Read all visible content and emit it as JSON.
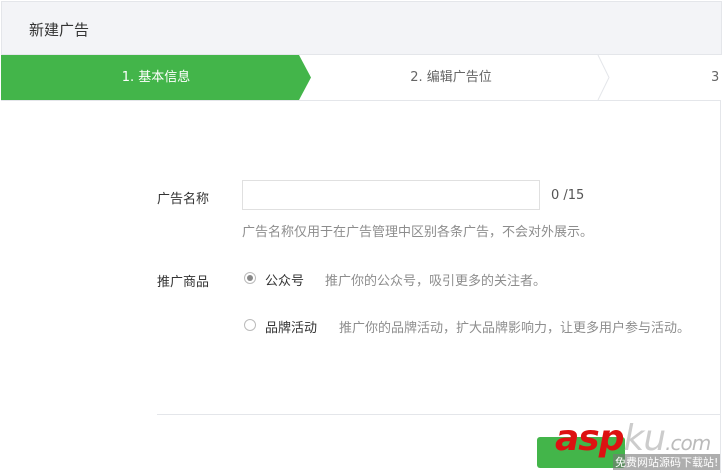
{
  "header": {
    "title": "新建广告"
  },
  "steps": [
    {
      "label": "1. 基本信息"
    },
    {
      "label": "2. 编辑广告位"
    },
    {
      "label": "3"
    }
  ],
  "form": {
    "name_label": "广告名称",
    "name_value": "",
    "name_count": "0 /15",
    "name_hint": "广告名称仅用于在广告管理中区别各条广告，不会对外展示。",
    "product_label": "推广商品",
    "options": [
      {
        "label": "公众号",
        "desc": "推广你的公众号，吸引更多的关注者。",
        "selected": true
      },
      {
        "label": "品牌活动",
        "desc": "推广你的品牌活动，扩大品牌影响力，让更多用户参与活动。",
        "selected": false
      }
    ]
  },
  "watermark": {
    "brand1": "asp",
    "brand2": "ku",
    "brand3": ".com",
    "slogan": "免费网站源码下载站!"
  },
  "colors": {
    "accent": "#43b54a"
  }
}
